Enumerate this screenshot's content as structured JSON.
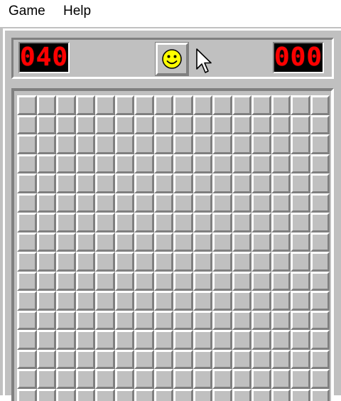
{
  "menu": {
    "items": [
      {
        "label": "Game"
      },
      {
        "label": "Help"
      }
    ]
  },
  "status": {
    "mines_remaining": "040",
    "timer": "000",
    "face": "smiley-icon",
    "lcd_color": "#ff0000",
    "face_color": "#ffff00"
  },
  "board": {
    "columns": 16,
    "visible_rows": 16,
    "cell_state": "unrevealed",
    "cell_color": "#c0c0c0"
  },
  "cursor": "mouse-pointer-icon"
}
